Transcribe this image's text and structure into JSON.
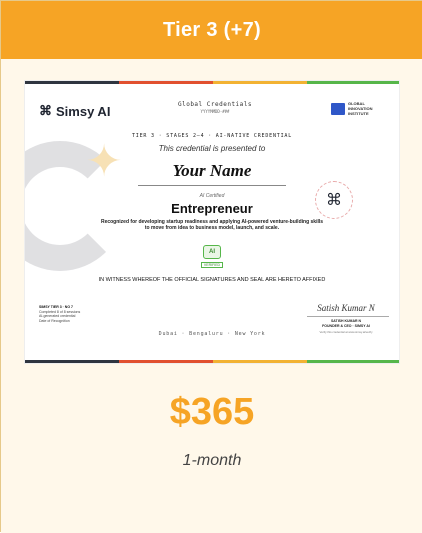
{
  "tier": {
    "title": "Tier 3 (+7)"
  },
  "certificate": {
    "brand": "Simsy AI",
    "global_credentials": "Global Credentials",
    "credential_id": "YYYYMMDD-###",
    "institute": [
      "GLOBAL",
      "INNOVATION",
      "INSTITUTE"
    ],
    "tier_line": "TIER 3 · STAGES 2–4 · AI-NATIVE CREDENTIAL",
    "presented_text": "This credential is presented to",
    "recipient_name": "Your Name",
    "certified_label": "AI Certified",
    "role": "Entrepreneur",
    "description": "Recognized for developing startup readiness and applying AI-powered venture-building skills to move from idea to business model, launch, and scale.",
    "ai_badge": "AI",
    "verified_label": "VERIFIED",
    "witness_text": "IN WITNESS WHEREOF THE OFFICIAL SIGNATURES AND SEAL ARE HERETO AFFIXED",
    "footer_left": [
      "SIMSY TIER 3 · NO 7",
      "Completed 8 of 8 sessions",
      "AI-generated credential",
      "Date of Recognition"
    ],
    "signature": "Satish Kumar N",
    "signer_name": "SATISH KUMAR N",
    "signer_title": "FOUNDER & CEO · SIMSY AI",
    "verify_text": "Verify this credential at www.simsy.ai/verify",
    "cities": "Dubai · Bengaluru · New York",
    "colors": {
      "dark": "#2f3540",
      "red": "#e1502f",
      "yellow": "#f2b233",
      "green": "#56b64a"
    }
  },
  "pricing": {
    "price": "$365",
    "period": "1-month"
  },
  "colors": {
    "accent": "#f6a425",
    "background": "#fff8ea"
  }
}
